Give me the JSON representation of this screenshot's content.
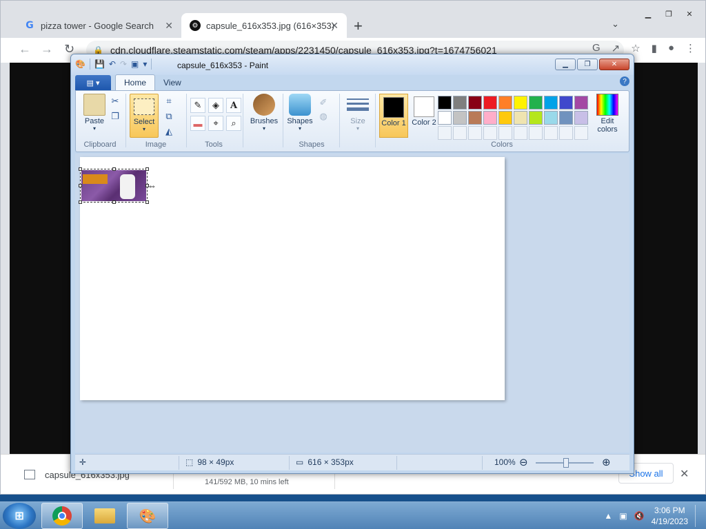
{
  "browser": {
    "tabs": [
      {
        "title": "pizza tower - Google Search",
        "icon": "google-icon",
        "active": false
      },
      {
        "title": "capsule_616x353.jpg (616×353)",
        "icon": "steam-icon",
        "active": true
      }
    ],
    "url": "cdn.cloudflare.steamstatic.com/steam/apps/2231450/capsule_616x353.jpg?t=1674756021",
    "downloads": {
      "file_name": "capsule_616x353.jpg",
      "progress_text": "141/592 MB, 10 mins left",
      "show_all_label": "Show all"
    }
  },
  "paint": {
    "title": "capsule_616x353 - Paint",
    "tabs": [
      "Home",
      "View"
    ],
    "groups": {
      "clipboard": {
        "label": "Clipboard",
        "paste_label": "Paste"
      },
      "image": {
        "label": "Image",
        "select_label": "Select"
      },
      "tools": {
        "label": "Tools"
      },
      "brushes": {
        "label": "Brushes"
      },
      "shapes": {
        "label": "Shapes",
        "shapes_label": "Shapes"
      },
      "size": {
        "label": "Size"
      },
      "colors": {
        "label": "Colors",
        "color1_label": "Color 1",
        "color2_label": "Color 2",
        "edit_label": "Edit colors",
        "color1": "#000000",
        "color2": "#ffffff",
        "palette_row1": [
          "#000000",
          "#7f7f7f",
          "#880015",
          "#ed1c24",
          "#ff7f27",
          "#fff200",
          "#22b14c",
          "#00a2e8",
          "#3f48cc",
          "#a349a4"
        ],
        "palette_row2": [
          "#ffffff",
          "#c3c3c3",
          "#b97a57",
          "#ffaec9",
          "#ffc90e",
          "#efe4b0",
          "#b5e61d",
          "#99d9ea",
          "#7092be",
          "#c8bfe7"
        ]
      }
    },
    "status": {
      "selection_size": "98 × 49px",
      "image_size": "616 × 353px",
      "zoom": "100%"
    }
  },
  "taskbar": {
    "time": "3:06 PM",
    "date": "4/19/2023",
    "apps": [
      "chrome-icon",
      "explorer-icon",
      "paint-icon"
    ]
  }
}
